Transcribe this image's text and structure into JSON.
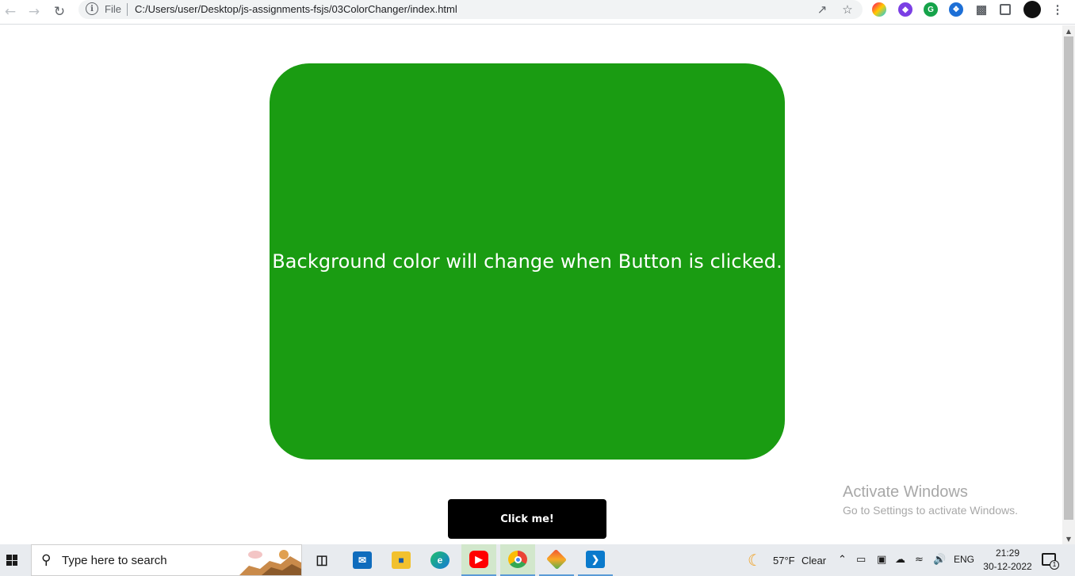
{
  "browser": {
    "scheme_label": "File",
    "url": "C:/Users/user/Desktop/js-assignments-fsjs/03ColorChanger/index.html"
  },
  "page": {
    "box_text": "Background color will change when Button is clicked.",
    "box_color": "#1a9c12",
    "button_label": "Click me!"
  },
  "watermark": {
    "title": "Activate Windows",
    "subtitle": "Go to Settings to activate Windows."
  },
  "taskbar": {
    "search_placeholder": "Type here to search",
    "apps": [
      "task-view",
      "mail",
      "file-explorer",
      "edge",
      "youtube",
      "chrome",
      "git",
      "vscode"
    ]
  },
  "tray": {
    "temperature": "57°F",
    "weather": "Clear",
    "language": "ENG",
    "time": "21:29",
    "date": "30-12-2022",
    "notification_count": "1"
  }
}
